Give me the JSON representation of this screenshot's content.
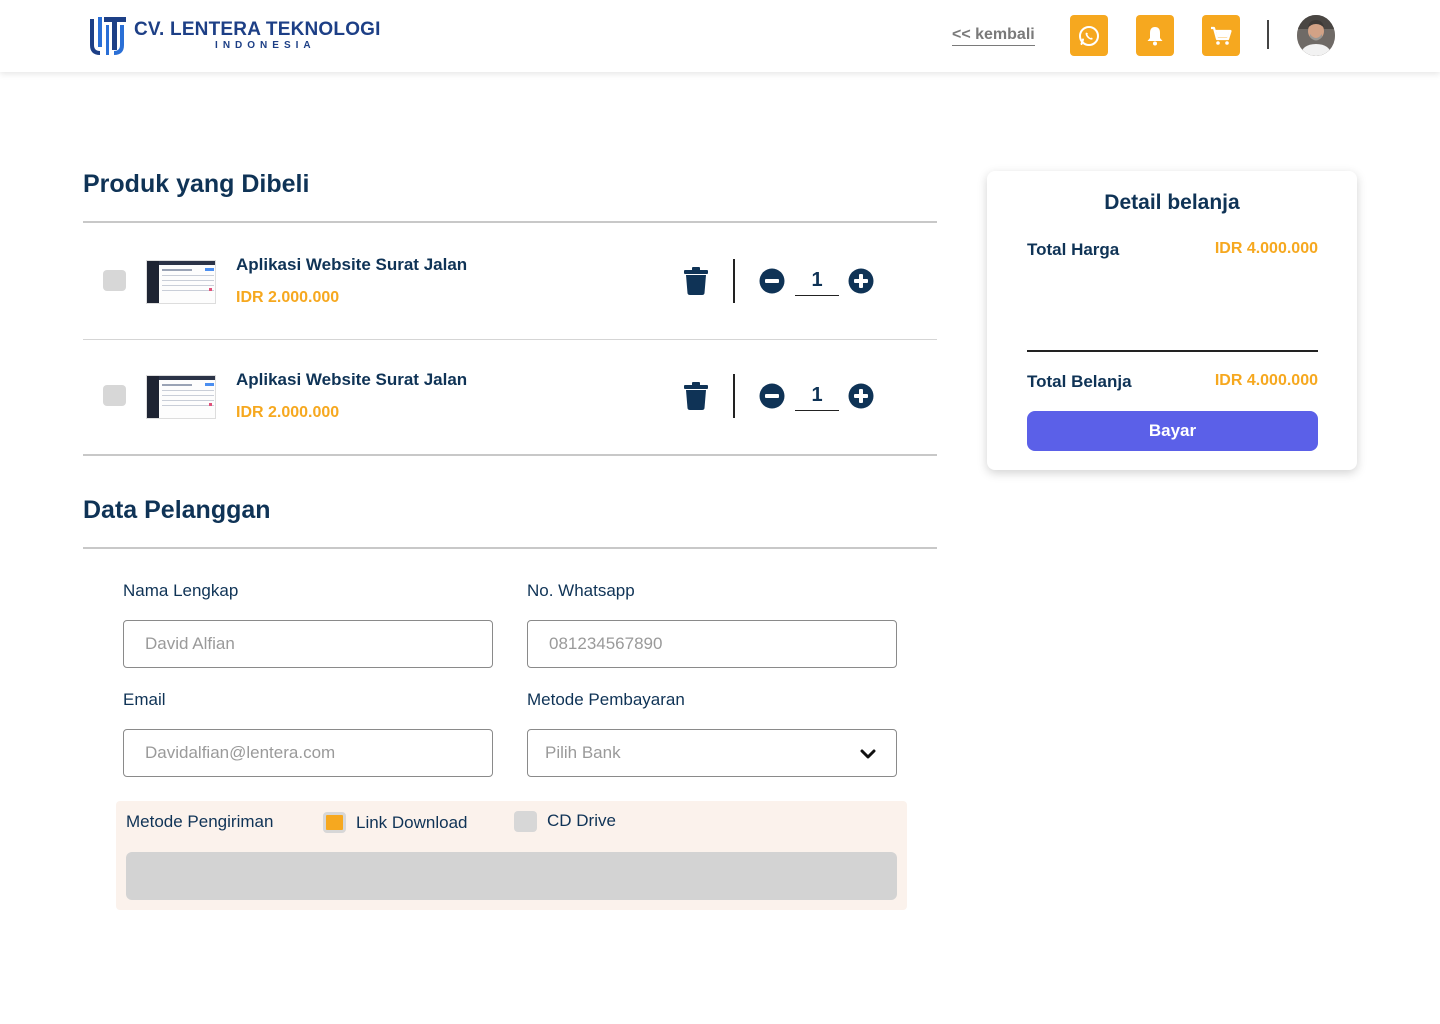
{
  "header": {
    "logo_title": "CV. LENTERA TEKNOLOGI",
    "logo_subtitle": "INDONESIA",
    "back_label": "<< kembali",
    "icons": [
      "whatsapp-icon",
      "bell-icon",
      "cart-icon"
    ],
    "accent_color": "#f6a81f"
  },
  "products_section": {
    "title": "Produk yang Dibeli",
    "items": [
      {
        "name": "Aplikasi Website Surat Jalan",
        "price": "IDR 2.000.000",
        "qty": "1",
        "checked": false
      },
      {
        "name": "Aplikasi Website Surat Jalan",
        "price": "IDR 2.000.000",
        "qty": "1",
        "checked": false
      }
    ]
  },
  "customer_section": {
    "title": "Data Pelanggan",
    "name_label": "Nama Lengkap",
    "name_placeholder": "David Alfian",
    "whatsapp_label": "No. Whatsapp",
    "whatsapp_placeholder": "081234567890",
    "email_label": "Email",
    "email_placeholder": "Davidalfian@lentera.com",
    "payment_label": "Metode Pembayaran",
    "payment_selected": "Pilih Bank",
    "shipping_label": "Metode Pengiriman",
    "shipping_options": [
      {
        "label": "Link Download",
        "selected": true
      },
      {
        "label": "CD Drive",
        "selected": false
      }
    ]
  },
  "summary": {
    "title": "Detail belanja",
    "total_price_label": "Total Harga",
    "total_price_value": "IDR 4.000.000",
    "total_shopping_label": "Total Belanja",
    "total_shopping_value": "IDR 4.000.000",
    "pay_label": "Bayar",
    "pay_color": "#5b60e8"
  }
}
